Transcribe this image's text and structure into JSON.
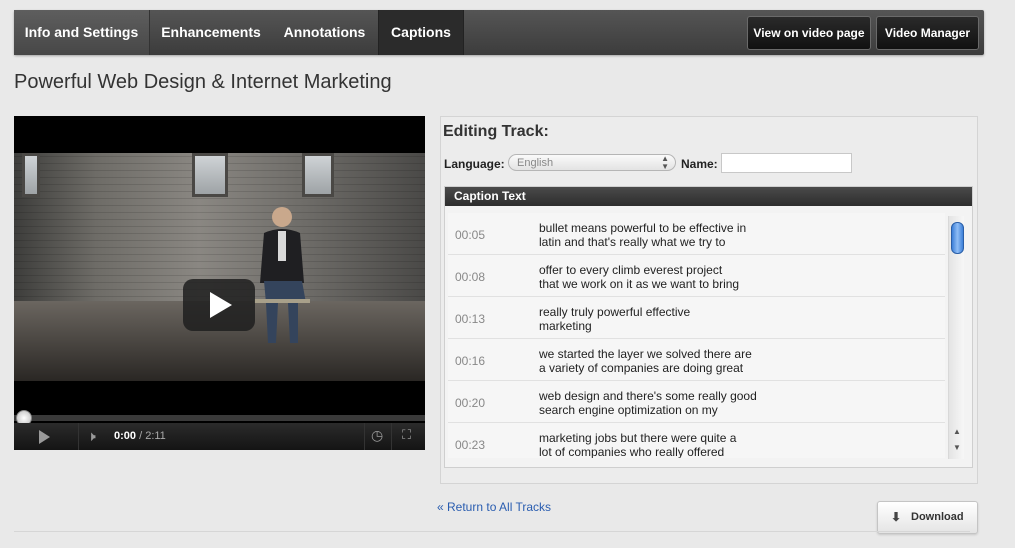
{
  "tabs": [
    {
      "label": "Info and Settings"
    },
    {
      "label": "Enhancements"
    },
    {
      "label": "Annotations"
    },
    {
      "label": "Captions",
      "active": true
    }
  ],
  "header_buttons": {
    "view_on_video_page": "View on video page",
    "video_manager": "Video Manager"
  },
  "page": {
    "title": "Powerful Web Design & Internet Marketing"
  },
  "player": {
    "current_time": "0:00",
    "total_time": "/ 2:11",
    "progress": 0
  },
  "editor": {
    "title": "Editing Track:",
    "language_label": "Language:",
    "language_value": "English",
    "name_label": "Name:",
    "name_value": "",
    "caption_header": "Caption Text",
    "captions": [
      {
        "time": "00:05",
        "line1": "bullet means powerful to be effective in",
        "line2": "latin and that's really what we try to"
      },
      {
        "time": "00:08",
        "line1": "offer to every climb everest project",
        "line2": "that we work on it as we want to bring"
      },
      {
        "time": "00:13",
        "line1": "really truly powerful effective",
        "line2": "marketing"
      },
      {
        "time": "00:16",
        "line1": "we started the layer we solved there are",
        "line2": "a variety of companies are doing great"
      },
      {
        "time": "00:20",
        "line1": "web design and there's some really good",
        "line2": "search engine optimization on my"
      },
      {
        "time": "00:23",
        "line1": "marketing jobs but there were quite a",
        "line2": "lot of companies who really offered"
      }
    ]
  },
  "footer": {
    "return_link": "« Return to All Tracks",
    "download_label": "Download"
  },
  "icons": {
    "play": "play-icon",
    "volume": "volume-icon",
    "clock": "clock-icon",
    "fullscreen": "fullscreen-icon",
    "download": "download-icon"
  },
  "colors": {
    "tab_bar": "#4a4a4a",
    "active_tab": "#2b2b2b",
    "link": "#2a5db0",
    "scroll_thumb": "#3c7fd8"
  }
}
